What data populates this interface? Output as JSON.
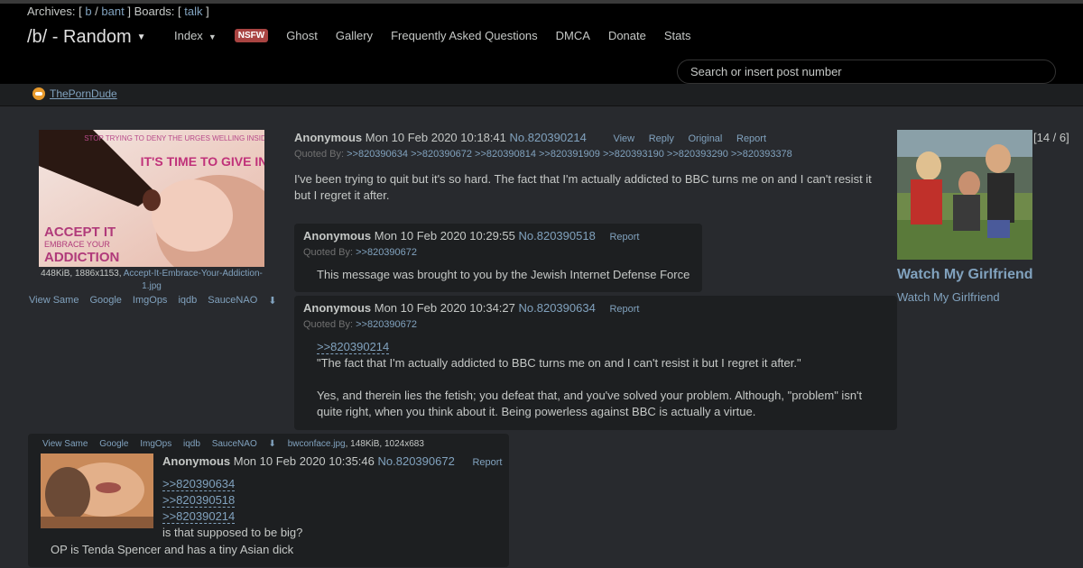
{
  "header": {
    "archives_label": "Archives: [",
    "archives_links": [
      "b",
      "bant"
    ],
    "archives_sep": "/",
    "archives_close": "]",
    "boards_label": "Boards: [",
    "boards_links": [
      "talk"
    ],
    "boards_close": "]",
    "board_title": "/b/ - Random",
    "nav": {
      "index": "Index",
      "nsfw": "NSFW",
      "ghost": "Ghost",
      "gallery": "Gallery",
      "faq": "Frequently Asked Questions",
      "dmca": "DMCA",
      "donate": "Donate",
      "stats": "Stats"
    },
    "search_placeholder": "Search or insert post number"
  },
  "sponsor": {
    "label": "ThePornDude"
  },
  "op": {
    "file_meta": "448KiB, 1886x1153,",
    "file_name": "Accept-It-Embrace-Your-Addiction-1.jpg",
    "image_tools": [
      "View Same",
      "Google",
      "ImgOps",
      "iqdb",
      "SauceNAO"
    ],
    "image_text": {
      "top": "STOP TRYING TO DENY THE URGES WELLING INSIDE OF YOU",
      "big": "IT'S TIME TO GIVE IN",
      "bottom1": "ACCEPT IT",
      "bottom2": "EMBRACE YOUR",
      "bottom3": "ADDICTION"
    },
    "name": "Anonymous",
    "date": "Mon 10 Feb 2020 10:18:41",
    "number": "No.820390214",
    "controls": [
      "View",
      "Reply",
      "Original",
      "Report"
    ],
    "quoted_by_label": "Quoted By:",
    "quoted_by": ">>820390634 >>820390672 >>820390814 >>820391909 >>820393190 >>820393290 >>820393378",
    "text": "I've been trying to quit but it's so hard. The fact that I'm actually addicted to BBC turns me on and I can't resist it but I regret it after."
  },
  "reply1": {
    "name": "Anonymous",
    "date": "Mon 10 Feb 2020 10:29:55",
    "number": "No.820390518",
    "report": "Report",
    "quoted_by_label": "Quoted By:",
    "quoted_by": ">>820390672",
    "text": "This message was brought to you by the Jewish Internet Defense Force"
  },
  "reply2": {
    "name": "Anonymous",
    "date": "Mon 10 Feb 2020 10:34:27",
    "number": "No.820390634",
    "report": "Report",
    "quoted_by_label": "Quoted By:",
    "quoted_by": ">>820390672",
    "quote_link": ">>820390214",
    "line1": "\"The fact that I'm actually addicted to BBC turns me on and I can't resist it but I regret it after.\"",
    "line2": "Yes, and therein lies the fetish; you defeat that, and you've solved your problem. Although, \"problem\" isn't quite right, when you think about it. Being powerless against BBC is actually a virtue."
  },
  "reply3": {
    "image_tools": [
      "View Same",
      "Google",
      "ImgOps",
      "iqdb",
      "SauceNAO"
    ],
    "file_name": "bwconface.jpg",
    "file_meta": ", 148KiB, 1024x683",
    "name": "Anonymous",
    "date": "Mon 10 Feb 2020 10:35:46",
    "number": "No.820390672",
    "report": "Report",
    "quote_links": [
      ">>820390634",
      ">>820390518",
      ">>820390214"
    ],
    "line1": "is that supposed to be big?",
    "line2": "OP is Tenda Spencer and has a tiny Asian dick"
  },
  "ad": {
    "count": "[14 / 6]",
    "title": "Watch My Girlfriend",
    "subtitle": "Watch My Girlfriend"
  }
}
